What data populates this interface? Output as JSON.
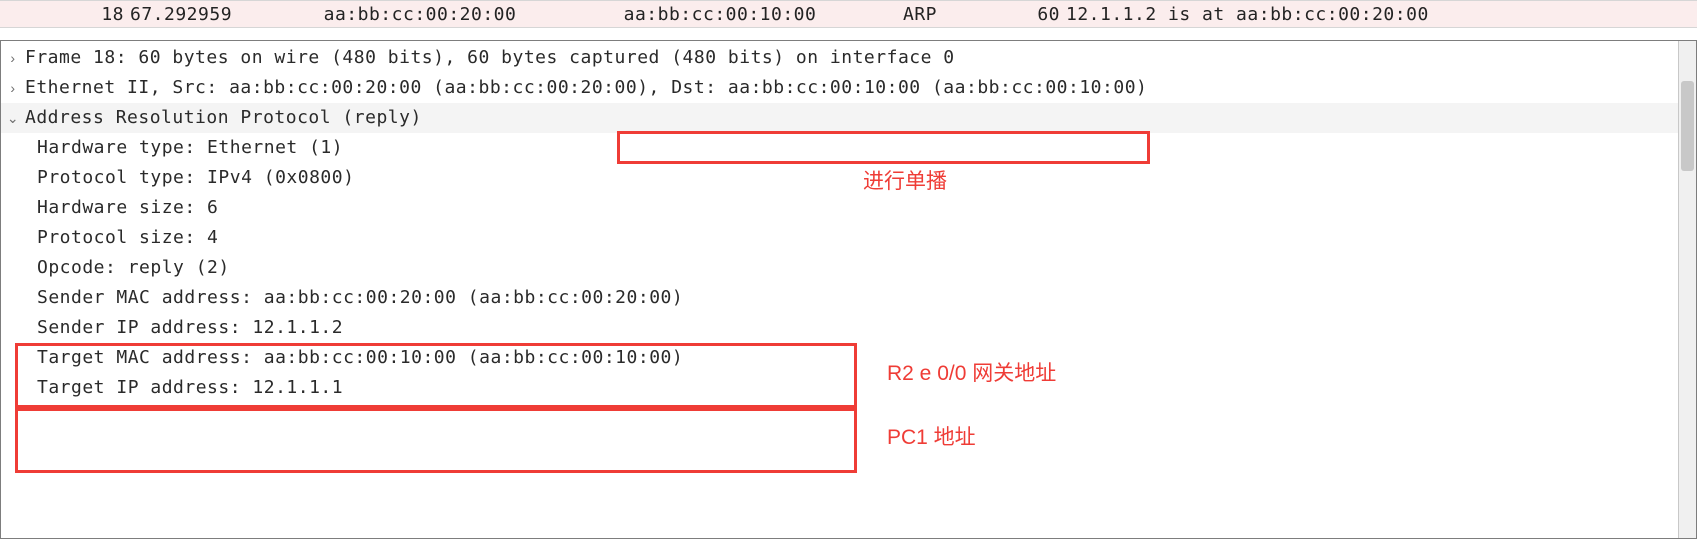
{
  "packet_row": {
    "no": "18",
    "time": "67.292959",
    "source": "aa:bb:cc:00:20:00",
    "destination": "aa:bb:cc:00:10:00",
    "protocol": "ARP",
    "length": "60",
    "info": "12.1.1.2 is at aa:bb:cc:00:20:00"
  },
  "tree": {
    "frame": "Frame 18: 60 bytes on wire (480 bits), 60 bytes captured (480 bits) on interface 0",
    "eth_prefix": "Ethernet II, Src: aa:bb:cc:00:20:00 (aa:bb:cc:00:20:00), ",
    "eth_dst": "Dst: aa:bb:cc:00:10:00 (aa:bb:cc:00:10:00)",
    "arp_header": "Address Resolution Protocol (reply)",
    "hw_type": "Hardware type: Ethernet (1)",
    "proto_type": "Protocol type: IPv4 (0x0800)",
    "hw_size": "Hardware size: 6",
    "proto_size": "Protocol size: 4",
    "opcode": "Opcode: reply (2)",
    "sender_mac": "Sender MAC address: aa:bb:cc:00:20:00 (aa:bb:cc:00:20:00)",
    "sender_ip": "Sender IP address: 12.1.1.2",
    "target_mac": "Target MAC address: aa:bb:cc:00:10:00 (aa:bb:cc:00:10:00)",
    "target_ip": "Target IP address: 12.1.1.1"
  },
  "annotations": {
    "unicast": "进行单播",
    "r2_gateway": "R2 e 0/0 网关地址",
    "pc1_addr": "PC1 地址"
  },
  "twisty": {
    "closed": "›",
    "open": "⌄"
  }
}
